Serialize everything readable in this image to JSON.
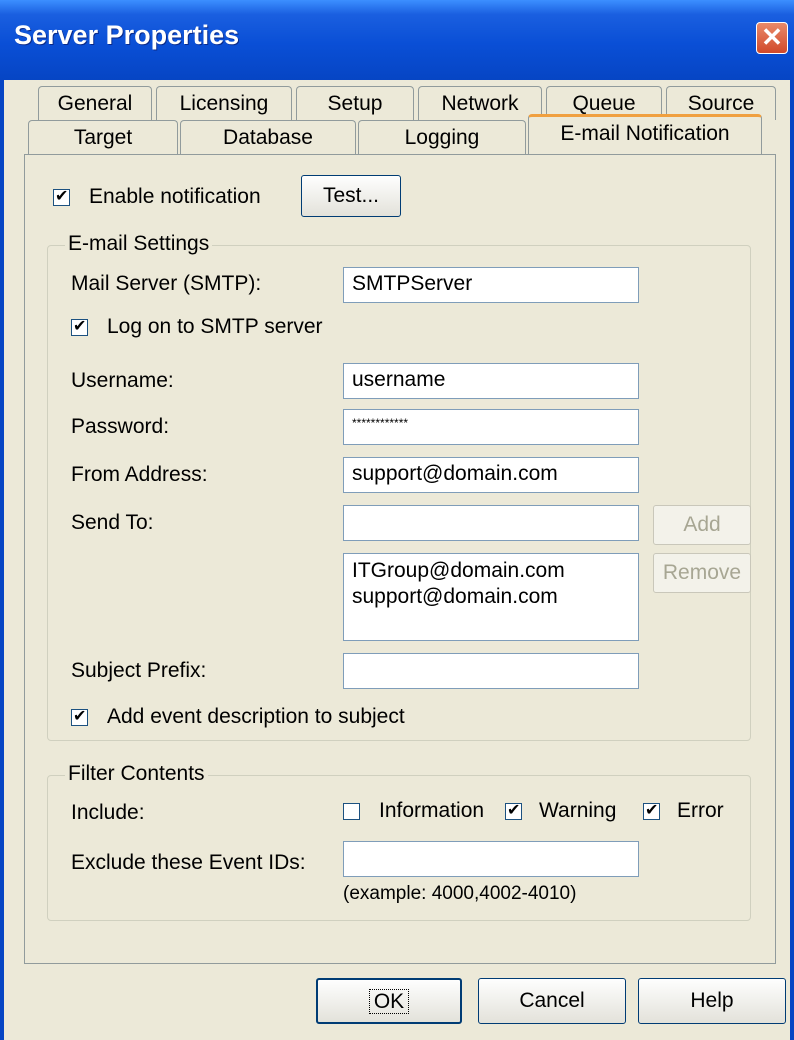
{
  "window": {
    "title": "Server Properties"
  },
  "tabs_row1": [
    "General",
    "Licensing",
    "Setup",
    "Network",
    "Queue",
    "Source"
  ],
  "tabs_row2": [
    "Target",
    "Database",
    "Logging",
    "E-mail Notification"
  ],
  "notification": {
    "enable_label": "Enable notification",
    "enabled": true,
    "test_label": "Test..."
  },
  "email": {
    "legend": "E-mail Settings",
    "mail_server_label": "Mail Server (SMTP):",
    "mail_server_value": "SMTPServer",
    "logon_label": "Log on to SMTP server",
    "logon_checked": true,
    "username_label": "Username:",
    "username_value": "username",
    "password_label": "Password:",
    "password_value": "************",
    "from_label": "From Address:",
    "from_value": "support@domain.com",
    "sendto_label": "Send To:",
    "sendto_value": "",
    "add_label": "Add",
    "remove_label": "Remove",
    "recipients": [
      "ITGroup@domain.com",
      "support@domain.com"
    ],
    "subject_label": "Subject Prefix:",
    "subject_value": "",
    "add_desc_label": "Add event description to subject",
    "add_desc_checked": true
  },
  "filter": {
    "legend": "Filter Contents",
    "include_label": "Include:",
    "information_label": "Information",
    "information_checked": false,
    "warning_label": "Warning",
    "warning_checked": true,
    "error_label": "Error",
    "error_checked": true,
    "exclude_label": "Exclude these Event IDs:",
    "exclude_value": "",
    "example": "(example: 4000,4002-4010)"
  },
  "buttons": {
    "ok": "OK",
    "cancel": "Cancel",
    "help": "Help"
  }
}
